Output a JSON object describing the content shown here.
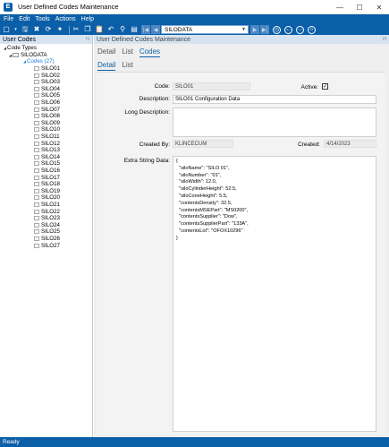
{
  "window": {
    "title": "User Defined Codes Maintenance",
    "app_icon_letter": "E",
    "controls": [
      "—",
      "☐",
      "✕"
    ]
  },
  "menubar": {
    "items": [
      "File",
      "Edit",
      "Tools",
      "Actions",
      "Help"
    ]
  },
  "toolbar": {
    "record_select_value": "SILODATA",
    "nav_first": "|◀",
    "nav_prev": "◀",
    "nav_next": "▶",
    "nav_last": "▶|"
  },
  "left_panel": {
    "title": "User Codes",
    "pin": "⊓",
    "tree": {
      "root_label": "Code Types",
      "group_label": "SILODATA",
      "codes_label": "Codes (27)",
      "codes": [
        "SILO01",
        "SILO02",
        "SILO03",
        "SILO04",
        "SILO05",
        "SILO06",
        "SILO07",
        "SILO08",
        "SILO09",
        "SILO10",
        "SILO11",
        "SILO12",
        "SILO13",
        "SILO14",
        "SILO15",
        "SILO16",
        "SILO17",
        "SILO18",
        "SILO19",
        "SILO20",
        "SILO21",
        "SILO22",
        "SILO23",
        "SILO24",
        "SILO25",
        "SILO26",
        "SILO27"
      ]
    }
  },
  "right_panel": {
    "title": "User Defined Codes Maintenance",
    "pin": "⊓",
    "outer_tabs": [
      "Detail",
      "List",
      "Codes"
    ],
    "inner_tabs": [
      "Detail",
      "List"
    ]
  },
  "form": {
    "code_label": "Code:",
    "code_value": "SILO01",
    "active_label": "Active:",
    "active_checked": "✓",
    "description_label": "Description:",
    "description_value": "SILO01 Configuration Data",
    "long_description_label": "Long Description:",
    "long_description_value": "",
    "created_by_label": "Created By:",
    "created_by_value": "KLINCECUM",
    "created_label": "Created:",
    "created_value": "4/14/2023",
    "extra_string_label": "Extra String Data:",
    "extra_string_value": "{\n  \"siloName\": \"SILO 01\",\n  \"siloNumber\": \"01\",\n  \"siloWidth\": 12.0,\n  \"siloCylinderHeight\": 52.5,\n  \"siloConeHeight\": 5.5,\n  \"contentsDensity\": 32.5,\n  \"contentsMSEPart\": \"MS0200\",\n  \"contentsSupplier\": \"Dow\",\n  \"contentsSupplierPart\": \"133A\",\n  \"contentsLot\": \"OFOX10296\"\n}"
  },
  "statusbar": {
    "text": "Ready"
  },
  "colors": {
    "brand_blue": "#0b5fa8",
    "tree_blue": "#1b7bd6",
    "panel_header": "#d6e4f2"
  }
}
